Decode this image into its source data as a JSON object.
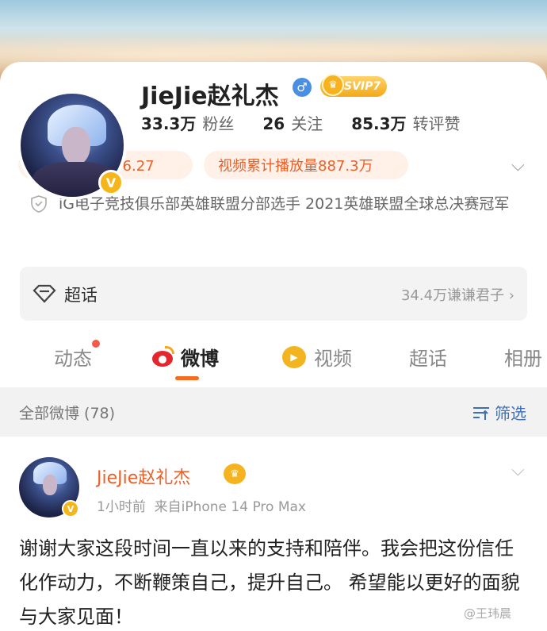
{
  "profile": {
    "name": "JieJie赵礼杰",
    "gender_icon": "♂",
    "svip_label": "SVIP7",
    "verified_badge": "V",
    "stats": [
      {
        "num": "33.3万",
        "label": "粉丝"
      },
      {
        "num": "26",
        "label": "关注"
      },
      {
        "num": "85.3万",
        "label": "转评赞"
      }
    ],
    "pills": {
      "power": "LPL 战力值  56.27",
      "video": "视频累计播放量887.3万"
    },
    "bio": "iG电子竞技俱乐部英雄联盟分部选手 2021英雄联盟全球总决赛冠军"
  },
  "topic": {
    "label": "超话",
    "right_text": "34.4万谦谦君子"
  },
  "tabs": [
    {
      "label": "动态"
    },
    {
      "label": "微博"
    },
    {
      "label": "视频"
    },
    {
      "label": "超话"
    },
    {
      "label": "相册"
    }
  ],
  "filter": {
    "left": "全部微博 (78)",
    "right": "筛选"
  },
  "post": {
    "author": "JieJie赵礼杰",
    "meta": "1小时前  来自iPhone 14 Pro Max",
    "text": "谢谢大家这段时间一直以来的支持和陪伴。我会把这份信任化作动力，不断鞭策自己，提升自己。 希望能以更好的面貌与大家见面！"
  },
  "watermark": "@王玮晨",
  "colors": {
    "accent_orange": "#e8612a",
    "link_blue": "#3e6fb4",
    "gold": "#f4b61a"
  }
}
